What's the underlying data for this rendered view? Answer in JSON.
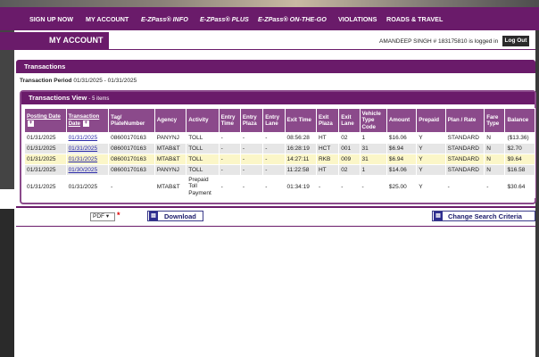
{
  "nav": [
    "SIGN UP NOW",
    "MY ACCOUNT",
    "E-ZPass® INFO",
    "E-ZPass® PLUS",
    "E-ZPass® ON-THE-GO",
    "VIOLATIONS",
    "ROADS & TRAVEL"
  ],
  "page_title": "MY ACCOUNT",
  "login_text": "AMANDEEP SINGH # 183175810 is logged in",
  "logout_label": "Log Out",
  "transactions_title": "Transactions",
  "transaction_period_label": "Transaction Period",
  "transaction_period_value": "01/31/2025 - 01/31/2025",
  "view_title": "Transactions View",
  "view_count": "- 5 items",
  "columns": [
    "Posting Date",
    "Transaction Date",
    "Tag/ PlateNumber",
    "Agency",
    "Activity",
    "Entry Time",
    "Entry Plaza",
    "Entry Lane",
    "Exit Time",
    "Exit Plaza",
    "Exit Lane",
    "Vehicle Type Code",
    "Amount",
    "Prepaid",
    "Plan / Rate",
    "Fare Type",
    "Balance"
  ],
  "rows": [
    [
      "01/31/2025",
      "01/31/2025",
      "08600170163",
      "PANYNJ",
      "TOLL",
      "-",
      "-",
      "-",
      "08:56:28",
      "HT",
      "02",
      "1",
      "$16.06",
      "Y",
      "STANDARD",
      "N",
      "($13.36)"
    ],
    [
      "01/31/2025",
      "01/31/2025",
      "08600170163",
      "MTAB&T",
      "TOLL",
      "-",
      "-",
      "-",
      "16:28:19",
      "HCT",
      "001",
      "31",
      "$6.94",
      "Y",
      "STANDARD",
      "N",
      "$2.70"
    ],
    [
      "01/31/2025",
      "01/31/2025",
      "08600170163",
      "MTAB&T",
      "TOLL",
      "-",
      "-",
      "-",
      "14:27:11",
      "RKB",
      "009",
      "31",
      "$6.94",
      "Y",
      "STANDARD",
      "N",
      "$9.64"
    ],
    [
      "01/31/2025",
      "01/30/2025",
      "08600170163",
      "PANYNJ",
      "TOLL",
      "-",
      "-",
      "-",
      "11:22:58",
      "HT",
      "02",
      "1",
      "$14.06",
      "Y",
      "STANDARD",
      "N",
      "$16.58"
    ],
    [
      "01/31/2025",
      "01/31/2025",
      "-",
      "MTAB&T",
      "Prepaid Toll Payment",
      "-",
      "-",
      "-",
      "01:34:19",
      "-",
      "-",
      "-",
      "$25.00",
      "Y",
      "-",
      "-",
      "$30.64"
    ]
  ],
  "format_select": "PDF",
  "download_label": "Download",
  "change_search_label": "Change Search Criteria",
  "colors": {
    "brand": "#6a1b6a",
    "header_cell": "#8b4a8b"
  },
  "icons": [
    "download-icon",
    "search-icon"
  ]
}
